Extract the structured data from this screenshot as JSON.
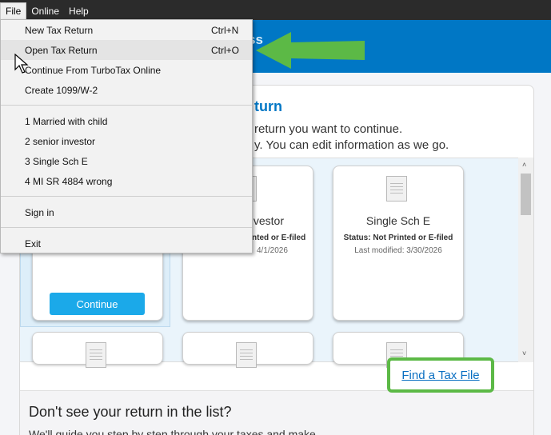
{
  "menubar": {
    "items": [
      "File",
      "Online",
      "Help"
    ]
  },
  "header": {
    "partial_text": "ss"
  },
  "main": {
    "title_partial": "turn",
    "subtitle_line1": "return you want to continue.",
    "subtitle_line2": "y.  You can edit information as we go."
  },
  "file_menu": {
    "new_tax_return": "New Tax Return",
    "new_tax_return_shortcut": "Ctrl+N",
    "open_tax_return": "Open Tax Return",
    "open_tax_return_shortcut": "Ctrl+O",
    "continue_turbotax_online": "Continue From TurboTax Online",
    "create_1099": "Create 1099/W-2",
    "recent1": "1 Married with child",
    "recent2": "2 senior investor",
    "recent3": "3 Single Sch E",
    "recent4": "4 MI SR 4884 wrong",
    "sign_in": "Sign in",
    "exit": "Exit"
  },
  "returns": {
    "tile2_name_partial": "vestor",
    "tile2_status_partial": "nted or E-filed",
    "tile2_modified_partial": "4/1/2026",
    "tile3_name": "Single Sch E",
    "tile3_status": "Status: Not Printed or E-filed",
    "tile3_modified": "Last modified: 3/30/2026",
    "continue_label": "Continue"
  },
  "find_link": "Find a Tax File",
  "bottom": {
    "heading": "Don't see your return in the list?",
    "text_partial": "We'll guide you step by step through your taxes and make"
  },
  "colors": {
    "accent": "#0077c5",
    "highlight_green": "#5cb946",
    "button_blue": "#1ba9e9"
  },
  "scroll_up_glyph": "˄",
  "scroll_down_glyph": "˅"
}
